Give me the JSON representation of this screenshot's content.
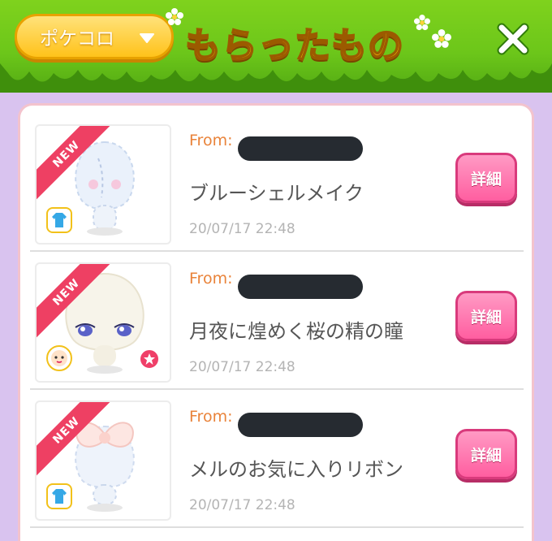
{
  "header": {
    "dropdown_label": "ポケコロ",
    "title": "もらったもの"
  },
  "colors": {
    "accent_pink": "#ff5ea0",
    "from_orange": "#e9833a",
    "new_ribbon": "#ee4063"
  },
  "items": [
    {
      "badge": "NEW",
      "from_prefix": "From:",
      "name": "ブルーシェルメイク",
      "date": "20/07/17 22:48",
      "detail_label": "詳細",
      "category_icon": "clothing-icon"
    },
    {
      "badge": "NEW",
      "from_prefix": "From:",
      "name": "月夜に煌めく桜の精の瞳",
      "date": "20/07/17 22:48",
      "detail_label": "詳細",
      "category_icon": "face-icon"
    },
    {
      "badge": "NEW",
      "from_prefix": "From:",
      "name": "メルのお気に入りリボン",
      "date": "20/07/17 22:48",
      "detail_label": "詳細",
      "category_icon": "clothing-icon"
    }
  ]
}
